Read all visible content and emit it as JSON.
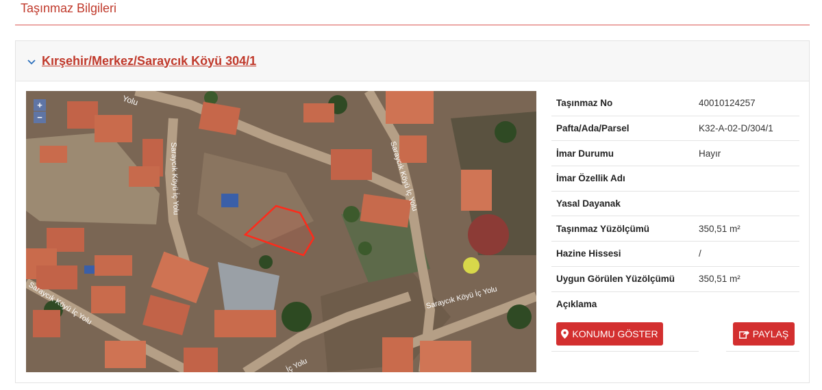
{
  "page": {
    "section_title": "Taşınmaz Bilgileri"
  },
  "parcel": {
    "title": "Kırşehir/Merkez/Saraycık Köyü 304/1"
  },
  "map": {
    "zoom_in": "+",
    "zoom_out": "−",
    "road_labels": [
      "Yolu",
      "Saraycık Köyü İç Yolu",
      "Saraycık Köyü İç Yolu",
      "Saraycık Köyü İç Yolu",
      "Saraycık Köyü İç Yolu",
      "İç Yolu"
    ]
  },
  "info": {
    "rows": [
      {
        "label": "Taşınmaz No",
        "value": "40010124257"
      },
      {
        "label": "Pafta/Ada/Parsel",
        "value": "K32-A-02-D/304/1"
      },
      {
        "label": "İmar Durumu",
        "value": "Hayır"
      },
      {
        "label": "İmar Özellik Adı",
        "value": ""
      },
      {
        "label": "Yasal Dayanak",
        "value": ""
      },
      {
        "label": "Taşınmaz Yüzölçümü",
        "value": "350,51 m²"
      },
      {
        "label": "Hazine Hissesi",
        "value": "/"
      },
      {
        "label": "Uygun Görülen Yüzölçümü",
        "value": "350,51 m²"
      },
      {
        "label": "Açıklama",
        "value": ""
      }
    ]
  },
  "buttons": {
    "show_location": "KONUMU GÖSTER",
    "share": "PAYLAŞ"
  },
  "colors": {
    "accent": "#d32f2f",
    "title_red": "#c0392b"
  },
  "icons": [
    "chevron-down-icon",
    "map-marker-icon",
    "share-icon"
  ]
}
